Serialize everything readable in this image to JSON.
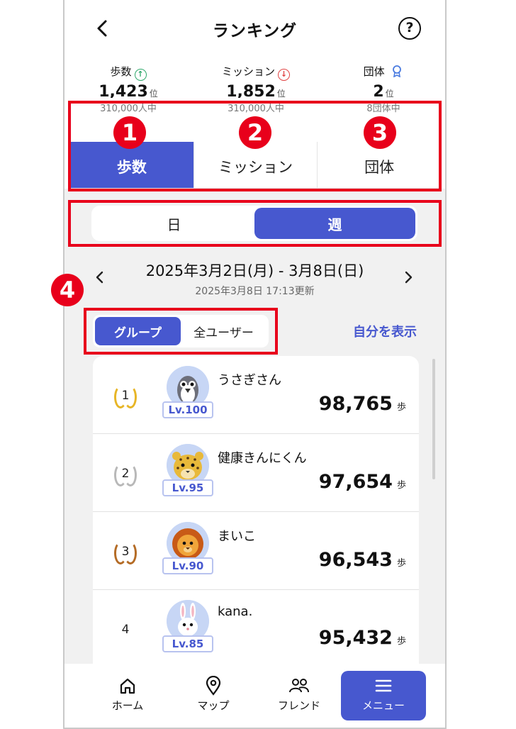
{
  "header": {
    "back_icon": "chevron-left-icon",
    "title": "ランキング",
    "help_icon": "help-circle-icon",
    "help_glyph": "?"
  },
  "summary": [
    {
      "label": "歩数",
      "trend_icon": "arrow-up-circle-icon",
      "trend_glyph": "↑",
      "trend_color": "#2fa86b",
      "value": "1,423",
      "unit": "位",
      "sub": "310,000人中"
    },
    {
      "label": "ミッション",
      "trend_icon": "arrow-down-circle-icon",
      "trend_glyph": "↓",
      "trend_color": "#e04343",
      "value": "1,852",
      "unit": "位",
      "sub": "310,000人中"
    },
    {
      "label": "団体",
      "trend_icon": "award-icon",
      "trend_glyph": "●",
      "trend_color": "#4a7be0",
      "value": "2",
      "unit": "位",
      "sub": "8団体中"
    }
  ],
  "main_tabs": [
    {
      "label": "歩数",
      "active": true
    },
    {
      "label": "ミッション",
      "active": false
    },
    {
      "label": "団体",
      "active": false
    }
  ],
  "period_tabs": [
    {
      "label": "日",
      "active": false
    },
    {
      "label": "週",
      "active": true
    }
  ],
  "date": {
    "prev_icon": "chevron-left-icon",
    "range": "2025年3月2日(月) - 3月8日(日)",
    "updated": "2025年3月8日 17:13更新",
    "next_icon": "chevron-right-icon"
  },
  "scope_tabs": [
    {
      "label": "グループ",
      "active": true
    },
    {
      "label": "全ユーザー",
      "active": false
    }
  ],
  "show_self": "自分を表示",
  "ranking": [
    {
      "rank": "1",
      "medal": "gold",
      "avatar_icon": "penguin-avatar-icon",
      "level": "Lv.100",
      "name": "うさぎさん",
      "steps": "98,765",
      "unit": "歩"
    },
    {
      "rank": "2",
      "medal": "silver",
      "avatar_icon": "leopard-avatar-icon",
      "level": "Lv.95",
      "name": "健康きんにくん",
      "steps": "97,654",
      "unit": "歩"
    },
    {
      "rank": "3",
      "medal": "bronze",
      "avatar_icon": "lion-avatar-icon",
      "level": "Lv.90",
      "name": "まいこ",
      "steps": "96,543",
      "unit": "歩"
    },
    {
      "rank": "4",
      "medal": "none",
      "avatar_icon": "rabbit-avatar-icon",
      "level": "Lv.85",
      "name": "kana.",
      "steps": "95,432",
      "unit": "歩"
    }
  ],
  "bottom_nav": [
    {
      "label": "ホーム",
      "icon": "home-icon",
      "active": false
    },
    {
      "label": "マップ",
      "icon": "map-pin-icon",
      "active": false
    },
    {
      "label": "フレンド",
      "icon": "friends-icon",
      "active": false
    },
    {
      "label": "メニュー",
      "icon": "menu-icon",
      "active": true
    }
  ],
  "annotations": [
    "1",
    "2",
    "3",
    "4"
  ],
  "colors": {
    "accent": "#4758cf",
    "annotation": "#e8001b"
  }
}
